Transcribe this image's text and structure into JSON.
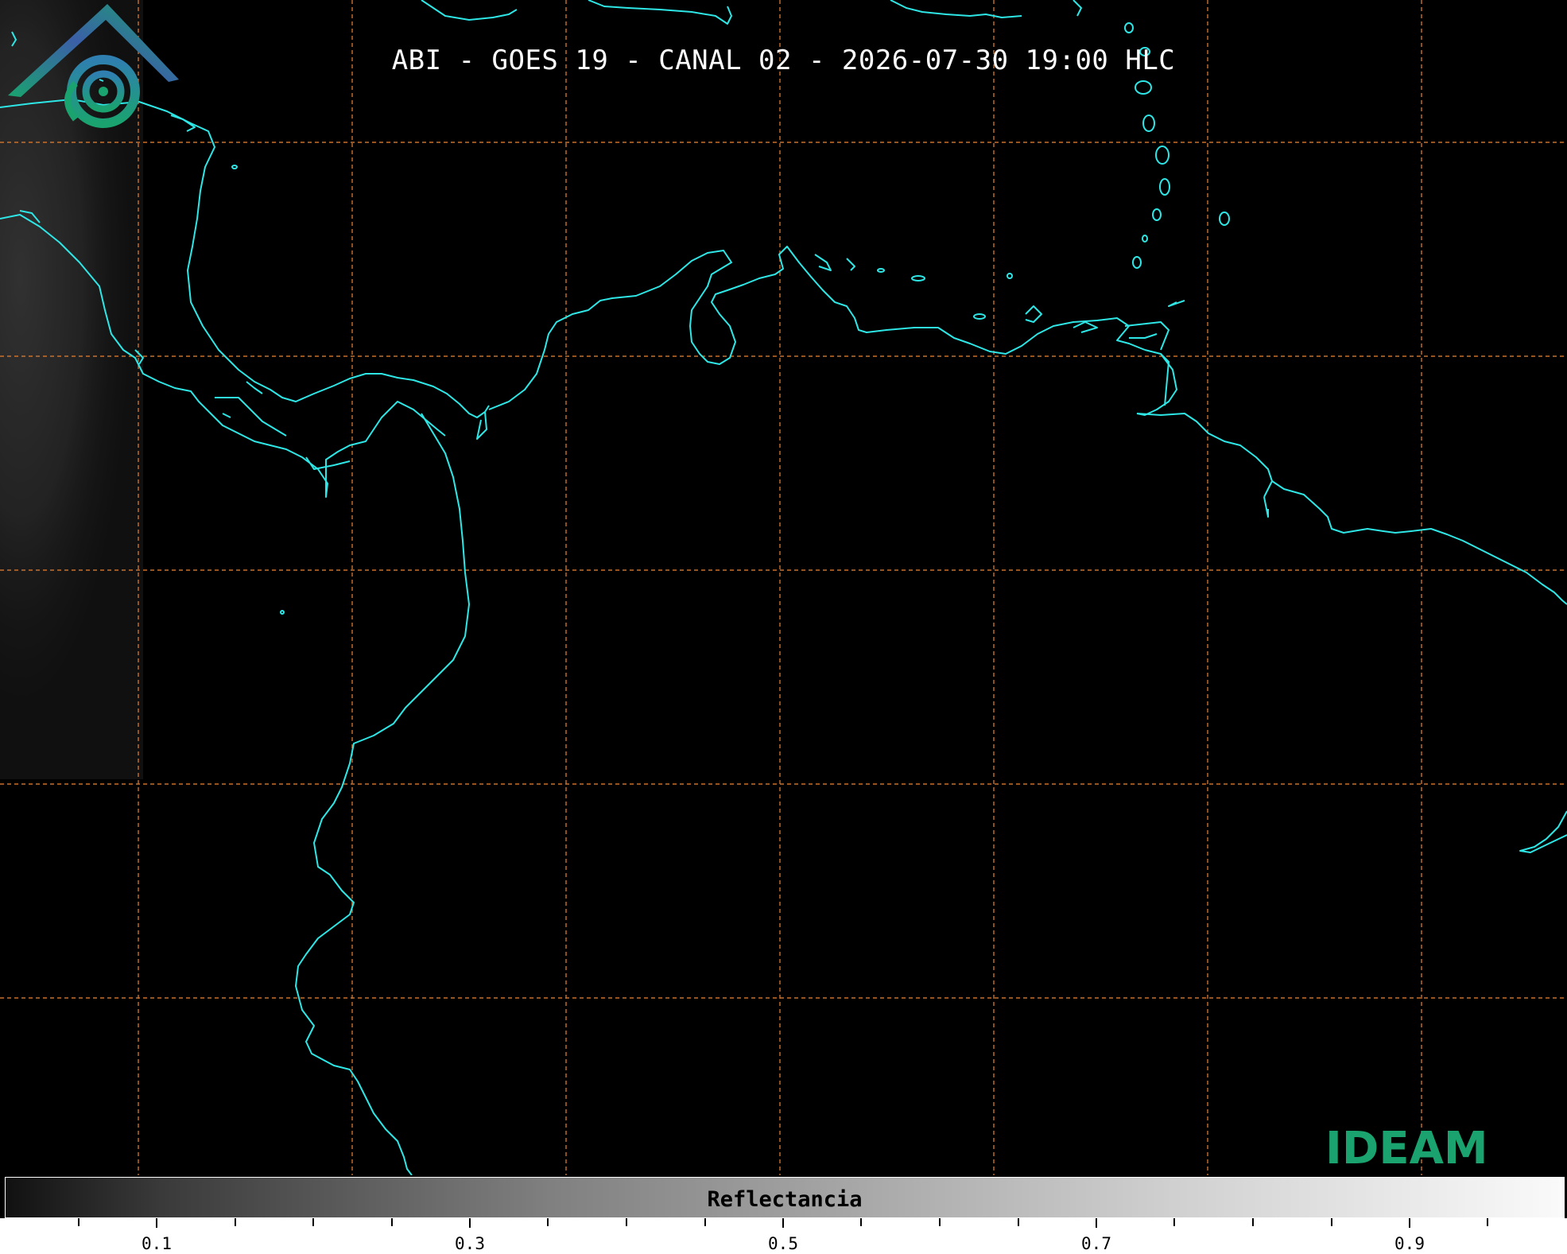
{
  "title": "ABI - GOES 19 - CANAL 02 - 2026-07-30 19:00 HLC",
  "colorbar": {
    "label": "Reflectancia",
    "tick_labels": [
      "0.1",
      "0.3",
      "0.5",
      "0.7",
      "0.9"
    ]
  },
  "logo": {
    "text": "IDEAM"
  },
  "colors": {
    "coastline": "#2ee6e6",
    "gridline": "#c8712f",
    "logo_text": "#1aa36f",
    "logo_roof": "#3b5fa8"
  }
}
